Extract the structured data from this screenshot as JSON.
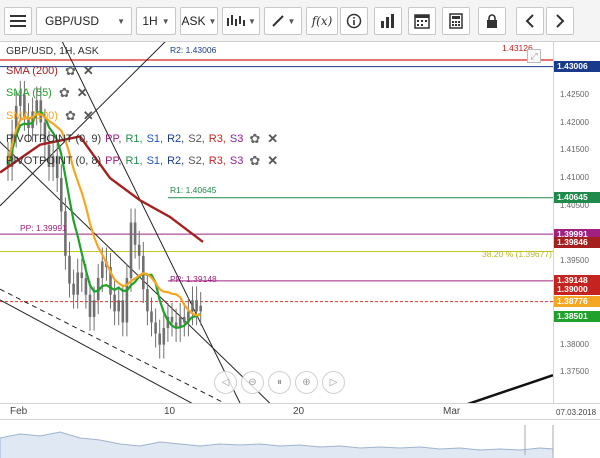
{
  "toolbar": {
    "symbol": "GBP/USD",
    "timeframe": "1H",
    "price_side": "ASK",
    "icons": [
      "hamburger-menu-icon",
      "candles-icon",
      "draw-tool-icon",
      "function-icon",
      "info-icon",
      "volume-bars-icon",
      "calendar-icon",
      "calculator-icon",
      "lock-icon",
      "chevron-left-icon",
      "chevron-right-icon"
    ],
    "function_label": "f(x)"
  },
  "legend": {
    "series_title": "GBP/USD, 1H, ASK",
    "sma200": "SMA (200)",
    "sma55": "SMA (55)",
    "sma100": "SMA (100)",
    "pivot1": "PIVOTPOINT (0, 9)",
    "pivot2": "PIVOTPOINT (0, 8)",
    "pivot_levels": [
      "PP,",
      "R1,",
      "S1,",
      "R2,",
      "S2,",
      "R3,",
      "S3"
    ]
  },
  "colors": {
    "sma200": "#a51f1f",
    "sma55": "#1fa12b",
    "sma100": "#f5a623",
    "pp": "#a0207f",
    "r1": "#1f8a4c",
    "r2": "#1a3a8c",
    "s1": "#2255c5",
    "s2": "#555555",
    "r3": "#c4231f",
    "s3": "#8a1f9e",
    "candle": "#707070",
    "fib": "#c8c820"
  },
  "chart_data": {
    "type": "candlestick",
    "y_ticks": [
      "1.42500",
      "1.42000",
      "1.41500",
      "1.41000",
      "1.40500",
      "1.40000",
      "1.39500",
      "1.39000",
      "1.38500",
      "1.38000",
      "1.37500"
    ],
    "x_ticks": [
      "Feb",
      "10",
      "20",
      "Mar",
      "07.03.2018"
    ],
    "ylim": [
      1.37,
      1.435
    ],
    "levels": {
      "r2": {
        "label": "R2: 1.43006",
        "value": 1.43006
      },
      "top_red": {
        "label": "1.43126",
        "value": 1.43126
      },
      "r1": {
        "label": "R1: 1.40645",
        "value": 1.40645
      },
      "pp_old": {
        "label": "PP: 1.39991",
        "value": 1.39991
      },
      "fib": {
        "label": "38.20 % (1.39677)",
        "value": 1.39677
      },
      "pp": {
        "label": "PP: 1.39148",
        "value": 1.39148
      },
      "current": {
        "value": 1.38776
      }
    },
    "price_tags": [
      {
        "text": "1.43006",
        "value": 1.43006,
        "color": "#1a3a8c"
      },
      {
        "text": "1.40645",
        "value": 1.40645,
        "color": "#1f8a4c"
      },
      {
        "text": "1.39991",
        "value": 1.39991,
        "color": "#a0207f"
      },
      {
        "text": "1.39846",
        "value": 1.39846,
        "color": "#a51f1f"
      },
      {
        "text": "1.39148",
        "value": 1.39148,
        "color": "#c4231f"
      },
      {
        "text": "1.39000",
        "value": 1.39,
        "color": "#c4231f"
      },
      {
        "text": "1.38776",
        "value": 1.38776,
        "color": "#f5a623"
      },
      {
        "text": "1.38501",
        "value": 1.38501,
        "color": "#1fa12b"
      }
    ],
    "closes": [
      1.412,
      1.418,
      1.423,
      1.425,
      1.421,
      1.419,
      1.422,
      1.424,
      1.42,
      1.416,
      1.412,
      1.414,
      1.41,
      1.404,
      1.396,
      1.391,
      1.389,
      1.393,
      1.392,
      1.389,
      1.385,
      1.388,
      1.392,
      1.395,
      1.394,
      1.389,
      1.386,
      1.388,
      1.384,
      1.392,
      1.402,
      1.398,
      1.396,
      1.39,
      1.386,
      1.384,
      1.382,
      1.38,
      1.383,
      1.385,
      1.384,
      1.383,
      1.385,
      1.384,
      1.386,
      1.388,
      1.386,
      1.387
    ]
  },
  "nav_buttons": [
    "nav-left",
    "zoom-out",
    "reset",
    "zoom-in",
    "nav-right"
  ]
}
